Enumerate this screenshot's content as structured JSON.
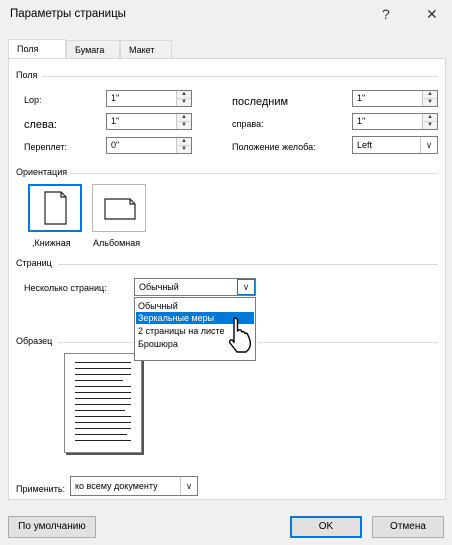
{
  "window": {
    "title": "Параметры страницы",
    "help_icon": "?",
    "close_icon": "✕"
  },
  "tabs": [
    {
      "label": "Поля",
      "active": true
    },
    {
      "label": "Бумага",
      "active": false
    },
    {
      "label": "Макет",
      "active": false
    }
  ],
  "margins": {
    "section_label": "Поля",
    "top_label": "Lop:",
    "top_value": "1\"",
    "bottom_label": "последним",
    "bottom_value": "1\"",
    "left_label": "слева:",
    "left_value": "1\"",
    "right_label": "справа:",
    "right_value": "1\"",
    "gutter_label": "Переплет:",
    "gutter_value": "0\"",
    "gutter_pos_label": "Положение желоба:",
    "gutter_pos_value": "Left"
  },
  "orientation": {
    "section_label": "Ориентация",
    "portrait_label": ",Книжная",
    "landscape_label": "Альбомная",
    "selected": "portrait"
  },
  "pages": {
    "section_label": "Страниц",
    "multiple_label": "Несколько страниц:",
    "multiple_value": "Обычный",
    "options": [
      "Обычный",
      "Зеркальные меры",
      "2 страницы на листе",
      "Брошюра"
    ],
    "highlighted_index": 1
  },
  "preview": {
    "section_label": "Образец"
  },
  "apply": {
    "label": "Применить:",
    "value": "ко всему документу"
  },
  "buttons": {
    "default_label": "По умолчанию",
    "ok_label": "OK",
    "cancel_label": "Отмена"
  },
  "colors": {
    "accent": "#0078d7",
    "background": "#f0f0f0"
  }
}
